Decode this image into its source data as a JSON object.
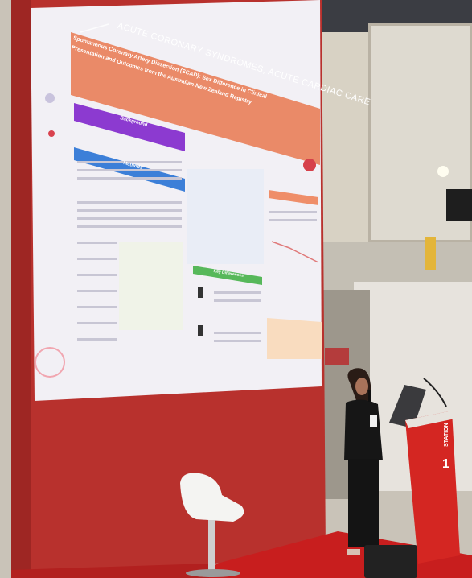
{
  "screen": {
    "banner": "ACUTE CORONARY SYNDROMES, ACUTE CARDIAC CARE",
    "poster_title_line1": "Spontaneous Coronary Artery Dissection (SCAD): Sex Difference in Clinical",
    "poster_title_line2": "Presentation and Outcomes from the Australian-New Zealand Registry",
    "section_background": "Background",
    "section_methods": "Methods",
    "section_results": "Key Differences"
  },
  "podium": {
    "label_station": "STATION",
    "label_number": "1"
  },
  "colors": {
    "wall_red": "#b8312d",
    "screen_white": "#f2f0f5",
    "poster_band": "#e9856a",
    "carpet_red": "#c81e1e"
  }
}
